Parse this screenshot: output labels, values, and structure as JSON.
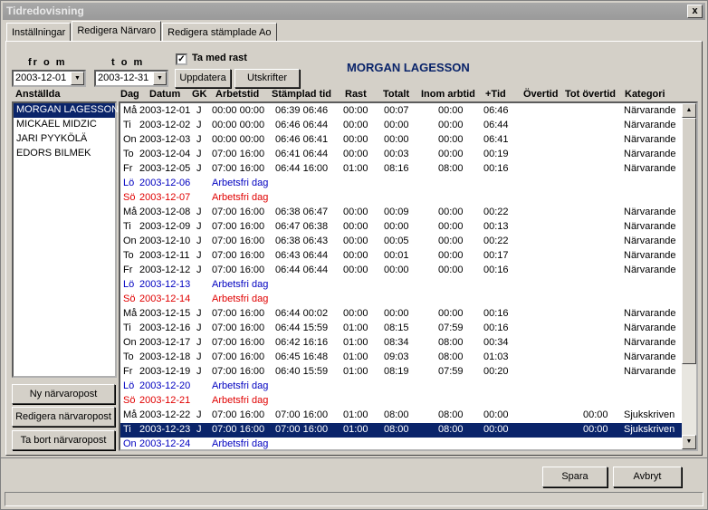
{
  "window": {
    "title": "Tidredovisning",
    "close_label": "x"
  },
  "tabs": [
    {
      "label": "Inställningar"
    },
    {
      "label": "Redigera Närvaro"
    },
    {
      "label": "Redigera stämplade Ao"
    }
  ],
  "filters": {
    "from_label": "fr o m",
    "tom_label": "t o m",
    "from_value": "2003-12-01",
    "to_value": "2003-12-31",
    "include_break_label": "Ta med rast",
    "include_break_checked": true,
    "update_button": "Uppdatera",
    "print_button": "Utskrifter"
  },
  "employee_name": "MORGAN LAGESSON",
  "employees": {
    "header": "Anställda",
    "items": [
      "MORGAN LAGESSON",
      "MICKAEL MIDZIC",
      "JARI PYYKÖLÄ",
      "EDORS BILMEK"
    ]
  },
  "actions": {
    "new": "Ny närvaropost",
    "edit": "Redigera närvaropost",
    "delete": "Ta bort närvaropost"
  },
  "columns": [
    "Dag",
    "Datum",
    "GK",
    "Arbetstid",
    "Stämplad tid",
    "Rast",
    "Totalt",
    "Inom arbtid",
    "+Tid",
    "Övertid",
    "Tot övertid",
    "Kategori"
  ],
  "rows": [
    {
      "day": "Må",
      "date": "2003-12-01",
      "gk": "J",
      "work": "00:00 00:00",
      "stamp": "06:39 06:46",
      "rast": "00:00",
      "total": "00:07",
      "inom": "00:00",
      "plus": "06:46",
      "over": "",
      "totover": "",
      "cat": "Närvarande",
      "type": "normal"
    },
    {
      "day": "Ti",
      "date": "2003-12-02",
      "gk": "J",
      "work": "00:00 00:00",
      "stamp": "06:46 06:44",
      "rast": "00:00",
      "total": "00:00",
      "inom": "00:00",
      "plus": "06:44",
      "over": "",
      "totover": "",
      "cat": "Närvarande",
      "type": "normal"
    },
    {
      "day": "On",
      "date": "2003-12-03",
      "gk": "J",
      "work": "00:00 00:00",
      "stamp": "06:46 06:41",
      "rast": "00:00",
      "total": "00:00",
      "inom": "00:00",
      "plus": "06:41",
      "over": "",
      "totover": "",
      "cat": "Närvarande",
      "type": "normal"
    },
    {
      "day": "To",
      "date": "2003-12-04",
      "gk": "J",
      "work": "07:00 16:00",
      "stamp": "06:41 06:44",
      "rast": "00:00",
      "total": "00:03",
      "inom": "00:00",
      "plus": "00:19",
      "over": "",
      "totover": "",
      "cat": "Närvarande",
      "type": "normal"
    },
    {
      "day": "Fr",
      "date": "2003-12-05",
      "gk": "J",
      "work": "07:00 16:00",
      "stamp": "06:44 16:00",
      "rast": "01:00",
      "total": "08:16",
      "inom": "08:00",
      "plus": "00:16",
      "over": "",
      "totover": "",
      "cat": "Närvarande",
      "type": "normal"
    },
    {
      "day": "Lö",
      "date": "2003-12-06",
      "gk": "",
      "work": "Arbetsfri dag",
      "stamp": "",
      "rast": "",
      "total": "",
      "inom": "",
      "plus": "",
      "over": "",
      "totover": "",
      "cat": "",
      "type": "sat"
    },
    {
      "day": "Sö",
      "date": "2003-12-07",
      "gk": "",
      "work": "Arbetsfri dag",
      "stamp": "",
      "rast": "",
      "total": "",
      "inom": "",
      "plus": "",
      "over": "",
      "totover": "",
      "cat": "",
      "type": "sun"
    },
    {
      "day": "Må",
      "date": "2003-12-08",
      "gk": "J",
      "work": "07:00 16:00",
      "stamp": "06:38 06:47",
      "rast": "00:00",
      "total": "00:09",
      "inom": "00:00",
      "plus": "00:22",
      "over": "",
      "totover": "",
      "cat": "Närvarande",
      "type": "normal"
    },
    {
      "day": "Ti",
      "date": "2003-12-09",
      "gk": "J",
      "work": "07:00 16:00",
      "stamp": "06:47 06:38",
      "rast": "00:00",
      "total": "00:00",
      "inom": "00:00",
      "plus": "00:13",
      "over": "",
      "totover": "",
      "cat": "Närvarande",
      "type": "normal"
    },
    {
      "day": "On",
      "date": "2003-12-10",
      "gk": "J",
      "work": "07:00 16:00",
      "stamp": "06:38 06:43",
      "rast": "00:00",
      "total": "00:05",
      "inom": "00:00",
      "plus": "00:22",
      "over": "",
      "totover": "",
      "cat": "Närvarande",
      "type": "normal"
    },
    {
      "day": "To",
      "date": "2003-12-11",
      "gk": "J",
      "work": "07:00 16:00",
      "stamp": "06:43 06:44",
      "rast": "00:00",
      "total": "00:01",
      "inom": "00:00",
      "plus": "00:17",
      "over": "",
      "totover": "",
      "cat": "Närvarande",
      "type": "normal"
    },
    {
      "day": "Fr",
      "date": "2003-12-12",
      "gk": "J",
      "work": "07:00 16:00",
      "stamp": "06:44 06:44",
      "rast": "00:00",
      "total": "00:00",
      "inom": "00:00",
      "plus": "00:16",
      "over": "",
      "totover": "",
      "cat": "Närvarande",
      "type": "normal"
    },
    {
      "day": "Lö",
      "date": "2003-12-13",
      "gk": "",
      "work": "Arbetsfri dag",
      "stamp": "",
      "rast": "",
      "total": "",
      "inom": "",
      "plus": "",
      "over": "",
      "totover": "",
      "cat": "",
      "type": "sat"
    },
    {
      "day": "Sö",
      "date": "2003-12-14",
      "gk": "",
      "work": "Arbetsfri dag",
      "stamp": "",
      "rast": "",
      "total": "",
      "inom": "",
      "plus": "",
      "over": "",
      "totover": "",
      "cat": "",
      "type": "sun"
    },
    {
      "day": "Må",
      "date": "2003-12-15",
      "gk": "J",
      "work": "07:00 16:00",
      "stamp": "06:44 00:02",
      "rast": "00:00",
      "total": "00:00",
      "inom": "00:00",
      "plus": "00:16",
      "over": "",
      "totover": "",
      "cat": "Närvarande",
      "type": "normal"
    },
    {
      "day": "Ti",
      "date": "2003-12-16",
      "gk": "J",
      "work": "07:00 16:00",
      "stamp": "06:44 15:59",
      "rast": "01:00",
      "total": "08:15",
      "inom": "07:59",
      "plus": "00:16",
      "over": "",
      "totover": "",
      "cat": "Närvarande",
      "type": "normal"
    },
    {
      "day": "On",
      "date": "2003-12-17",
      "gk": "J",
      "work": "07:00 16:00",
      "stamp": "06:42 16:16",
      "rast": "01:00",
      "total": "08:34",
      "inom": "08:00",
      "plus": "00:34",
      "over": "",
      "totover": "",
      "cat": "Närvarande",
      "type": "normal"
    },
    {
      "day": "To",
      "date": "2003-12-18",
      "gk": "J",
      "work": "07:00 16:00",
      "stamp": "06:45 16:48",
      "rast": "01:00",
      "total": "09:03",
      "inom": "08:00",
      "plus": "01:03",
      "over": "",
      "totover": "",
      "cat": "Närvarande",
      "type": "normal"
    },
    {
      "day": "Fr",
      "date": "2003-12-19",
      "gk": "J",
      "work": "07:00 16:00",
      "stamp": "06:40 15:59",
      "rast": "01:00",
      "total": "08:19",
      "inom": "07:59",
      "plus": "00:20",
      "over": "",
      "totover": "",
      "cat": "Närvarande",
      "type": "normal"
    },
    {
      "day": "Lö",
      "date": "2003-12-20",
      "gk": "",
      "work": "Arbetsfri dag",
      "stamp": "",
      "rast": "",
      "total": "",
      "inom": "",
      "plus": "",
      "over": "",
      "totover": "",
      "cat": "",
      "type": "sat"
    },
    {
      "day": "Sö",
      "date": "2003-12-21",
      "gk": "",
      "work": "Arbetsfri dag",
      "stamp": "",
      "rast": "",
      "total": "",
      "inom": "",
      "plus": "",
      "over": "",
      "totover": "",
      "cat": "",
      "type": "sun"
    },
    {
      "day": "Må",
      "date": "2003-12-22",
      "gk": "J",
      "work": "07:00 16:00",
      "stamp": "07:00 16:00",
      "rast": "01:00",
      "total": "08:00",
      "inom": "08:00",
      "plus": "00:00",
      "over": "",
      "totover": "00:00",
      "cat": "Sjukskriven",
      "type": "normal"
    },
    {
      "day": "Ti",
      "date": "2003-12-23",
      "gk": "J",
      "work": "07:00 16:00",
      "stamp": "07:00 16:00",
      "rast": "01:00",
      "total": "08:00",
      "inom": "08:00",
      "plus": "00:00",
      "over": "",
      "totover": "00:00",
      "cat": "Sjukskriven",
      "type": "sel"
    },
    {
      "day": "On",
      "date": "2003-12-24",
      "gk": "",
      "work": "Arbetsfri dag",
      "stamp": "",
      "rast": "",
      "total": "",
      "inom": "",
      "plus": "",
      "over": "",
      "totover": "",
      "cat": "",
      "type": "sat"
    }
  ],
  "footer": {
    "save": "Spara",
    "cancel": "Avbryt"
  },
  "icons": {
    "dropdown": "chevron-down-icon",
    "scroll_up": "arrow-up-icon",
    "scroll_down": "arrow-down-icon",
    "check": "checkmark-icon"
  },
  "colors": {
    "selection": "#0a246a",
    "saturday": "#0000c0",
    "sunday": "#e00000"
  }
}
